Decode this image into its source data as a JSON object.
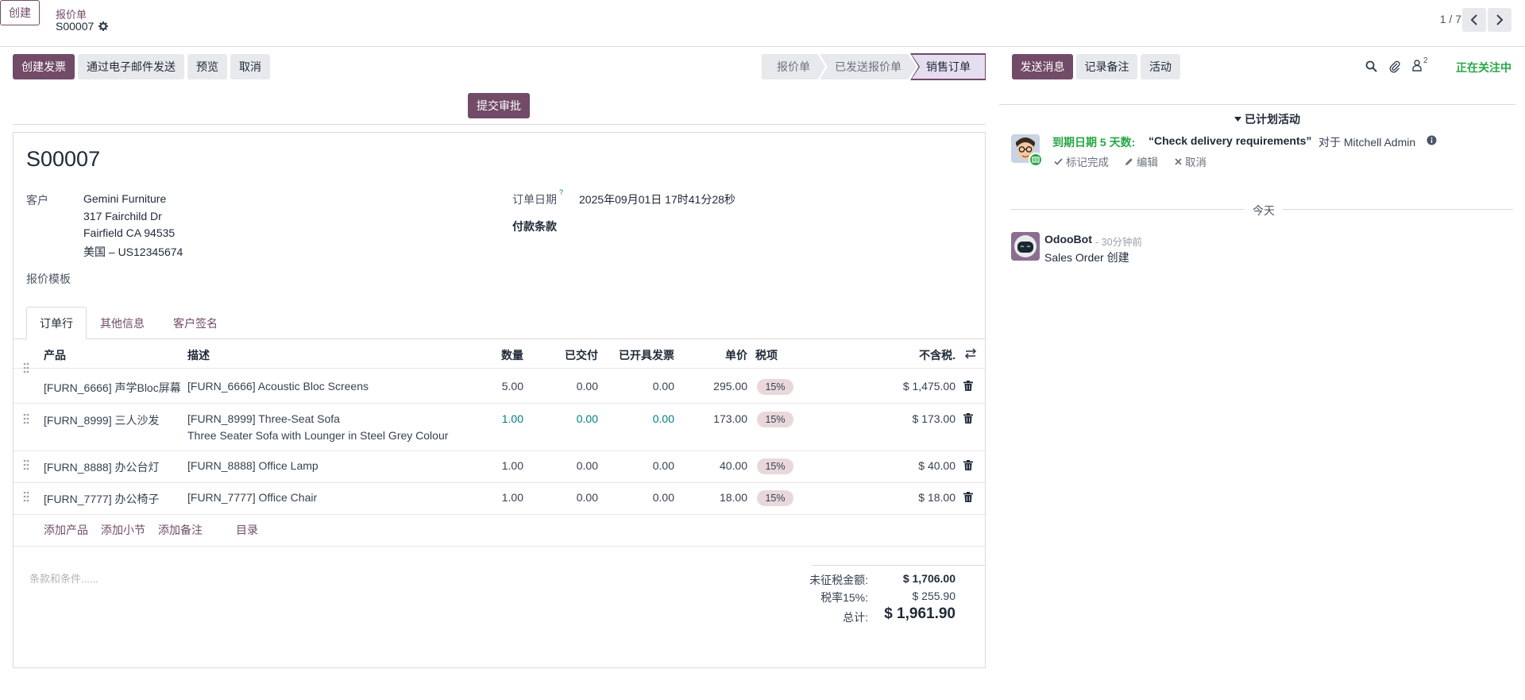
{
  "control_panel": {
    "create_label": "创建",
    "breadcrumb_parent": "报价单",
    "record_name": "S00007",
    "pager": "1 / 7"
  },
  "actions": {
    "create_invoice": "创建发票",
    "send_email": "通过电子邮件发送",
    "preview": "预览",
    "cancel": "取消",
    "submit_approval": "提交审批"
  },
  "statusbar": {
    "stages": [
      "报价单",
      "已发送报价单",
      "销售订单"
    ],
    "active": "销售订单"
  },
  "chatter": {
    "send_message": "发送消息",
    "log_note": "记录备注",
    "activity": "活动",
    "followers_count": "2",
    "following": "正在关注中",
    "planned_activities": "已计划活动",
    "activity_due": "到期日期 5 天数:",
    "activity_title": "“Check delivery requirements”",
    "activity_for": "对于 Mitchell Admin",
    "mark_done": "标记完成",
    "edit": "编辑",
    "cancel": "取消",
    "today": "今天",
    "message_author": "OdooBot",
    "message_time": "- 30分钟前",
    "message_body": "Sales Order 创建"
  },
  "form": {
    "title": "S00007",
    "customer_label": "客户",
    "customer_name": "Gemini Furniture",
    "address_line1": "317 Fairchild Dr",
    "address_line2": "Fairfield CA 94535",
    "address_line3": "美国 – US12345674",
    "template_label": "报价模板",
    "order_date_label": "订单日期",
    "order_date_help": "?",
    "order_date_value": "2025年09月01日 17时41分28秒",
    "payment_terms_label": "付款条款"
  },
  "tabs": [
    "订单行",
    "其他信息",
    "客户签名"
  ],
  "order_lines": {
    "headers": {
      "product": "产品",
      "description": "描述",
      "quantity": "数量",
      "delivered": "已交付",
      "invoiced": "已开具发票",
      "unit_price": "单价",
      "taxes": "税项",
      "subtotal": "不含税."
    },
    "rows": [
      {
        "product": "[FURN_6666] 声学Bloc屏幕",
        "description": "[FURN_6666] Acoustic Bloc Screens",
        "description2": "",
        "quantity": "5.00",
        "delivered": "0.00",
        "invoiced": "0.00",
        "unit_price": "295.00",
        "tax": "15%",
        "subtotal": "$ 1,475.00"
      },
      {
        "product": "[FURN_8999] 三人沙发",
        "description": "[FURN_8999] Three-Seat Sofa",
        "description2": "Three Seater Sofa with Lounger in Steel Grey Colour",
        "quantity": "1.00",
        "delivered": "0.00",
        "invoiced": "0.00",
        "unit_price": "173.00",
        "tax": "15%",
        "subtotal": "$ 173.00"
      },
      {
        "product": "[FURN_8888] 办公台灯",
        "description": "[FURN_8888] Office Lamp",
        "description2": "",
        "quantity": "1.00",
        "delivered": "0.00",
        "invoiced": "0.00",
        "unit_price": "40.00",
        "tax": "15%",
        "subtotal": "$ 40.00"
      },
      {
        "product": "[FURN_7777] 办公椅子",
        "description": "[FURN_7777] Office Chair",
        "description2": "",
        "quantity": "1.00",
        "delivered": "0.00",
        "invoiced": "0.00",
        "unit_price": "18.00",
        "tax": "15%",
        "subtotal": "$ 18.00"
      }
    ],
    "add_product": "添加产品",
    "add_section": "添加小节",
    "add_note": "添加备注",
    "catalog": "目录"
  },
  "terms_placeholder": "条款和条件......",
  "totals": {
    "untaxed_label": "未征税金额:",
    "untaxed_value": "$ 1,706.00",
    "tax_label": "税率15%:",
    "tax_value": "$ 255.90",
    "total_label": "总计:",
    "total_value": "$ 1,961.90"
  },
  "colors": {
    "brand": "#714b67",
    "following": "#28a745",
    "due": "#28a745",
    "secondary_button": "#e7e9ed",
    "tax_badge": "#e9d8da"
  }
}
